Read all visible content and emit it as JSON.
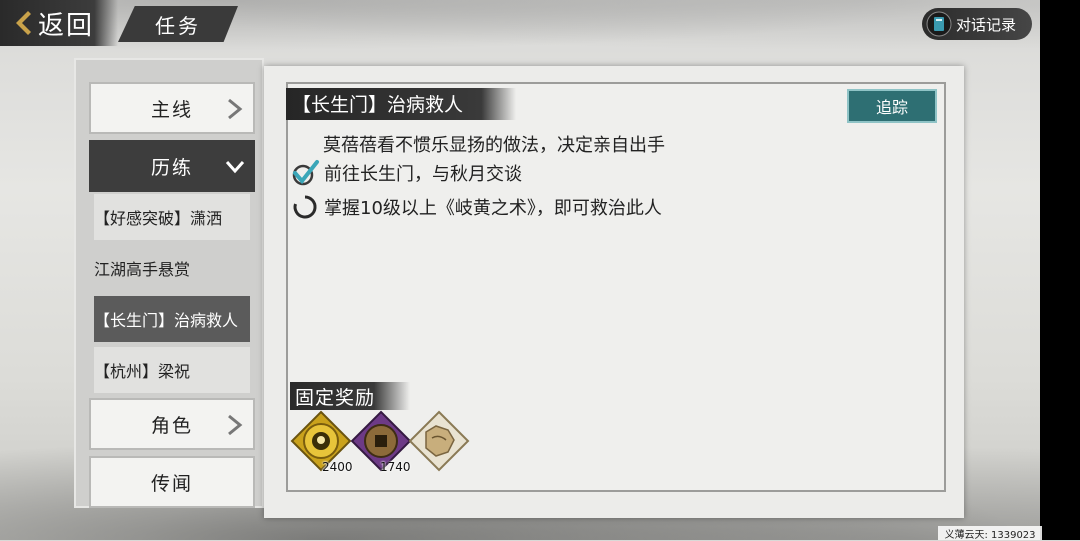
{
  "header": {
    "back_label": "返回",
    "title": "任务",
    "dialog_log_label": "对话记录"
  },
  "sidebar": {
    "categories": [
      {
        "label": "主线",
        "state": "collapsed"
      },
      {
        "label": "历练",
        "state": "expanded"
      },
      {
        "label": "角色",
        "state": "collapsed"
      },
      {
        "label": "传闻",
        "state": "collapsed"
      }
    ],
    "subitems": [
      {
        "label": "【好感突破】潇洒"
      },
      {
        "label": "江湖高手悬赏"
      },
      {
        "label": "【长生门】治病救人",
        "selected": true
      },
      {
        "label": "【杭州】梁祝"
      }
    ]
  },
  "quest": {
    "title": "【长生门】治病救人",
    "track_label": "追踪",
    "description": "莫蓓蓓看不惯乐显扬的做法，决定亲自出手",
    "objectives": [
      {
        "text": "前往长生门，与秋月交谈",
        "status": "done",
        "icon": "check-icon"
      },
      {
        "text": "掌握10级以上《岐黄之术》，即可救治此人",
        "status": "in-progress",
        "icon": "progress-ring-icon"
      }
    ],
    "rewards_title": "固定奖励",
    "rewards": [
      {
        "icon": "gold-medallion-icon",
        "count": "2400",
        "color": "#d9b422"
      },
      {
        "icon": "purple-coin-icon",
        "count": "1740",
        "color": "#7a3d8f"
      },
      {
        "icon": "map-scroll-icon",
        "count": "",
        "color": "#b8a27a"
      }
    ]
  },
  "footer": {
    "player_info": "义薄云天: 1339023"
  },
  "colors": {
    "track_button": "#2e6f73",
    "selected_item": "#5b5b5b",
    "active_category": "#3d3d3d"
  }
}
